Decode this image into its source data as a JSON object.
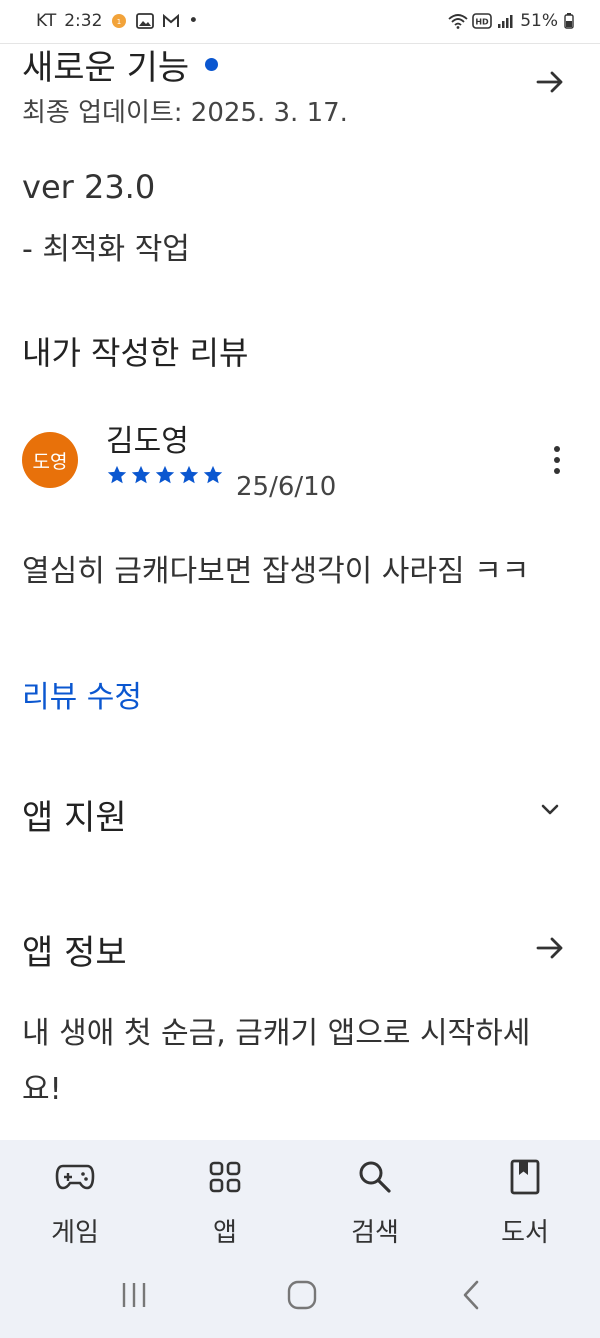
{
  "status_bar": {
    "carrier": "KT",
    "time": "2:32",
    "battery": "51%"
  },
  "whats_new": {
    "title": "새로운 기능",
    "updated": "최종 업데이트: 2025. 3. 17.",
    "version": "ver 23.0",
    "notes": "- 최적화 작업"
  },
  "my_review": {
    "title": "내가 작성한 리뷰",
    "avatar_text": "도영",
    "reviewer_name": "김도영",
    "rating": 5,
    "date": "25/6/10",
    "text": "열심히 금캐다보면 잡생각이 사라짐 ㅋㅋ",
    "edit_label": "리뷰 수정"
  },
  "app_support": {
    "title": "앱 지원"
  },
  "app_info": {
    "title": "앱 정보",
    "description": "내 생애 첫 순금, 금캐기 앱으로 시작하세요!"
  },
  "bottom_nav": {
    "items": [
      {
        "label": "게임",
        "icon": "gamepad-icon"
      },
      {
        "label": "앱",
        "icon": "apps-grid-icon"
      },
      {
        "label": "검색",
        "icon": "search-icon"
      },
      {
        "label": "도서",
        "icon": "book-icon"
      }
    ]
  },
  "colors": {
    "accent": "#0b57d0",
    "avatar": "#e8710a",
    "nav_bg": "#eef1f7"
  }
}
